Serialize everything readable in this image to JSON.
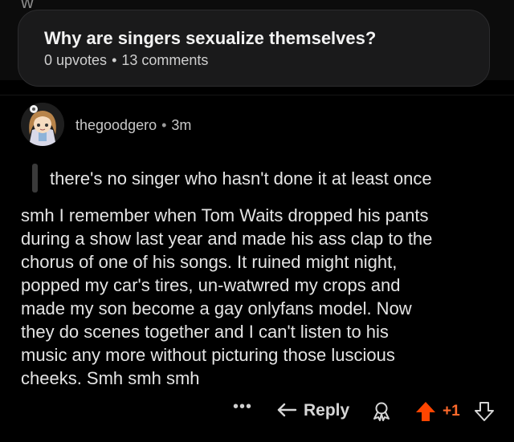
{
  "post": {
    "title": "Why are singers sexualize themselves?",
    "upvotes": "0 upvotes",
    "separator": "•",
    "comments": "13 comments"
  },
  "comment": {
    "username": "thegoodgero",
    "separator": "•",
    "time": "3m",
    "quote": "there's no singer who hasn't done it at least once",
    "body_lines": [
      "smh I remember when Tom Waits dropped his pants",
      "during a show last year and made his ass clap to the",
      "chorus of one of his songs.  It ruined might night,",
      "popped my car's tires, un-watwred my crops and",
      "made my son become a gay onlyfans model. Now",
      "they do scenes together and I can't listen to his",
      "music any more without picturing those luscious",
      "cheeks. Smh smh smh"
    ]
  },
  "actions": {
    "more": "•••",
    "reply": "Reply",
    "score": "+1"
  },
  "icons": {
    "more": "more-options-icon",
    "reply": "reply-arrow-icon",
    "award": "award-icon",
    "upvote": "upvote-arrow-icon",
    "downvote": "downvote-arrow-icon"
  },
  "colors": {
    "background": "#000000",
    "card": "#1a1a1b",
    "upvote_active": "#ff4500",
    "score": "#ff6a2b"
  }
}
